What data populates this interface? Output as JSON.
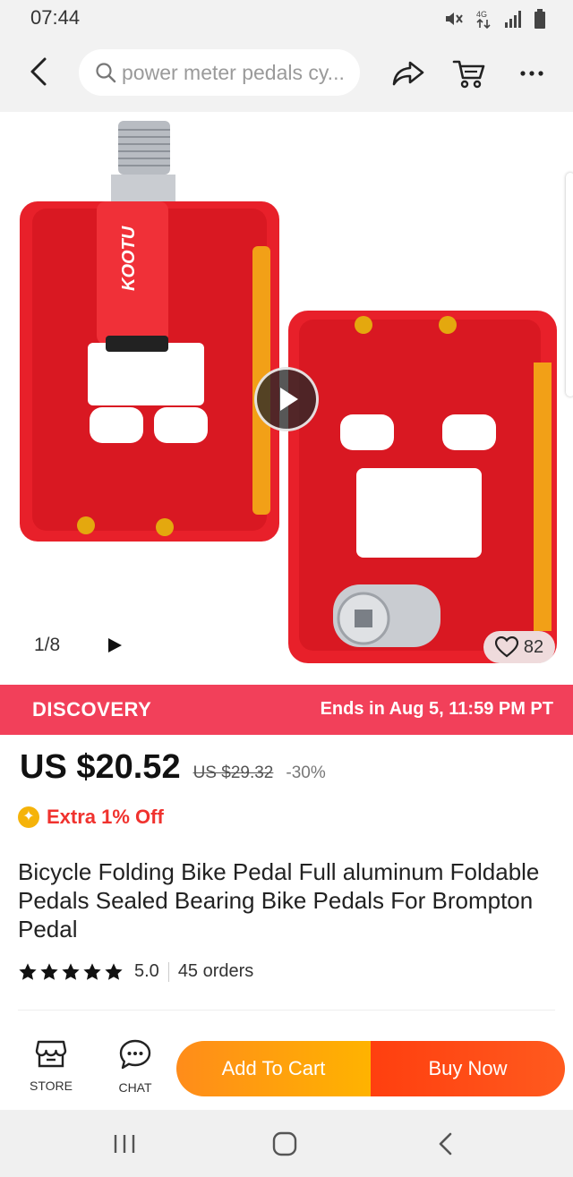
{
  "status_bar": {
    "time": "07:44",
    "icons": [
      "mute-icon",
      "data-4g-icon",
      "signal-icon",
      "battery-icon"
    ]
  },
  "top_nav": {
    "search_text": "power meter pedals cy...",
    "icons": [
      "back-arrow-icon",
      "search-icon",
      "share-icon",
      "cart-icon",
      "more-icon"
    ]
  },
  "gallery": {
    "page_indicator": "1/8",
    "like_count": "82",
    "brand_mark": "KOOTU"
  },
  "promo": {
    "label": "DISCOVERY",
    "ends": "Ends in Aug 5, 11:59 PM PT"
  },
  "price": {
    "current": "US $20.52",
    "original": "US $29.32",
    "discount": "-30%",
    "extra_off": "Extra 1% Off"
  },
  "product": {
    "title": "Bicycle Folding Bike Pedal Full aluminum Foldable Pedals Sealed Bearing Bike Pedals For Brompton Pedal",
    "rating": "5.0",
    "rating_stars": 5,
    "orders": "45 orders"
  },
  "actions": {
    "store_label": "STORE",
    "chat_label": "CHAT",
    "add_to_cart": "Add To Cart",
    "buy_now": "Buy Now"
  },
  "colors": {
    "promo_bg": "#f2405a",
    "price_highlight": "#f0322e",
    "add_cart_start": "#ff8c1a",
    "add_cart_end": "#ffb300",
    "buy_now": "#ff4516",
    "product_red": "#e8202a"
  }
}
